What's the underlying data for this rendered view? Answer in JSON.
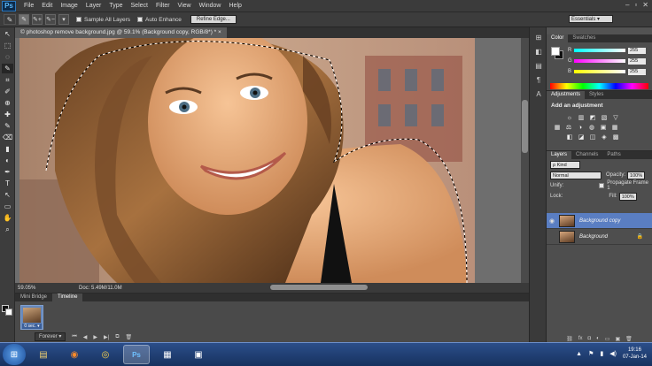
{
  "app": {
    "logo": "Ps",
    "menu": [
      "File",
      "Edit",
      "Image",
      "Layer",
      "Type",
      "Select",
      "Filter",
      "View",
      "Window",
      "Help"
    ],
    "window_buttons": [
      "–",
      "▫",
      "✕"
    ],
    "workspace_select": "Essentials ▾"
  },
  "options": {
    "tool_glyph": "✎",
    "mode_icons": [
      "✎",
      "✎+",
      "✎−"
    ],
    "brush_size": "▾",
    "sample_all_layers": "Sample All Layers",
    "auto_enhance": "Auto Enhance",
    "refine_edge": "Refine Edge..."
  },
  "tools": [
    "↖",
    "⬚",
    "◌",
    "✎",
    "⌗",
    "✐",
    "⊕",
    "✚",
    "✎",
    "⌫",
    "▮",
    "◐",
    "✒",
    "T",
    "↖",
    "▭",
    "✋",
    "⌕"
  ],
  "document": {
    "tab_title": "© photoshop remove background.jpg @ 59.1% (Background copy, RGB/8*) *",
    "tab_close": "×",
    "zoom": "59.05%",
    "doc_size": "Doc: 5.49M/11.0M"
  },
  "bottom": {
    "tabs": [
      "Mini Bridge",
      "Timeline"
    ],
    "frame_time": "0 sec. ▾",
    "loop": "Forever ▾",
    "controls": [
      "⏮",
      "◀",
      "▶",
      "▶|",
      "⧉",
      "🗑"
    ]
  },
  "dock_icons": [
    "⊞",
    "◧",
    "▤",
    "¶",
    "A"
  ],
  "color_panel": {
    "tabs": [
      "Color",
      "Swatches"
    ],
    "sliders": [
      {
        "label": "R",
        "value": "255",
        "gradient": "linear-gradient(90deg,#00ffff,#ffffff)"
      },
      {
        "label": "G",
        "value": "255",
        "gradient": "linear-gradient(90deg,#ff00ff,#ffffff)"
      },
      {
        "label": "B",
        "value": "255",
        "gradient": "linear-gradient(90deg,#ffff00,#ffffff)"
      }
    ]
  },
  "adjustments": {
    "tabs": [
      "Adjustments",
      "Styles"
    ],
    "title": "Add an adjustment",
    "row1": [
      "☼",
      "▥",
      "◩",
      "▧",
      "▽"
    ],
    "row2": [
      "▦",
      "⚖",
      "◑",
      "◍",
      "▣",
      "▦"
    ],
    "row3": [
      "◧",
      "◪",
      "◫",
      "◈",
      "▩"
    ]
  },
  "layers": {
    "tabs": [
      "Layers",
      "Channels",
      "Paths"
    ],
    "filter": "ρ Kind",
    "blend_mode": "Normal",
    "opacity_label": "Opacity:",
    "opacity": "100%",
    "unify_label": "Unify:",
    "propagate": "Propagate Frame 1",
    "lock_label": "Lock:",
    "fill_label": "Fill:",
    "fill": "100%",
    "items": [
      {
        "name": "Background copy",
        "visible": "◉"
      },
      {
        "name": "Background",
        "visible": ""
      }
    ],
    "lock_icon": "🔒",
    "footer": [
      "⛓",
      "fx",
      "◘",
      "◐",
      "▭",
      "▣",
      "🗑"
    ]
  },
  "taskbar": {
    "start": "⊞",
    "apps": [
      "▤",
      "◉",
      "◎",
      "Ps",
      "▦",
      "▣"
    ],
    "tray_icons": [
      "▲",
      "⚑",
      "▮",
      "◀)"
    ],
    "time": "19:16",
    "date": "07-Jan-14"
  }
}
